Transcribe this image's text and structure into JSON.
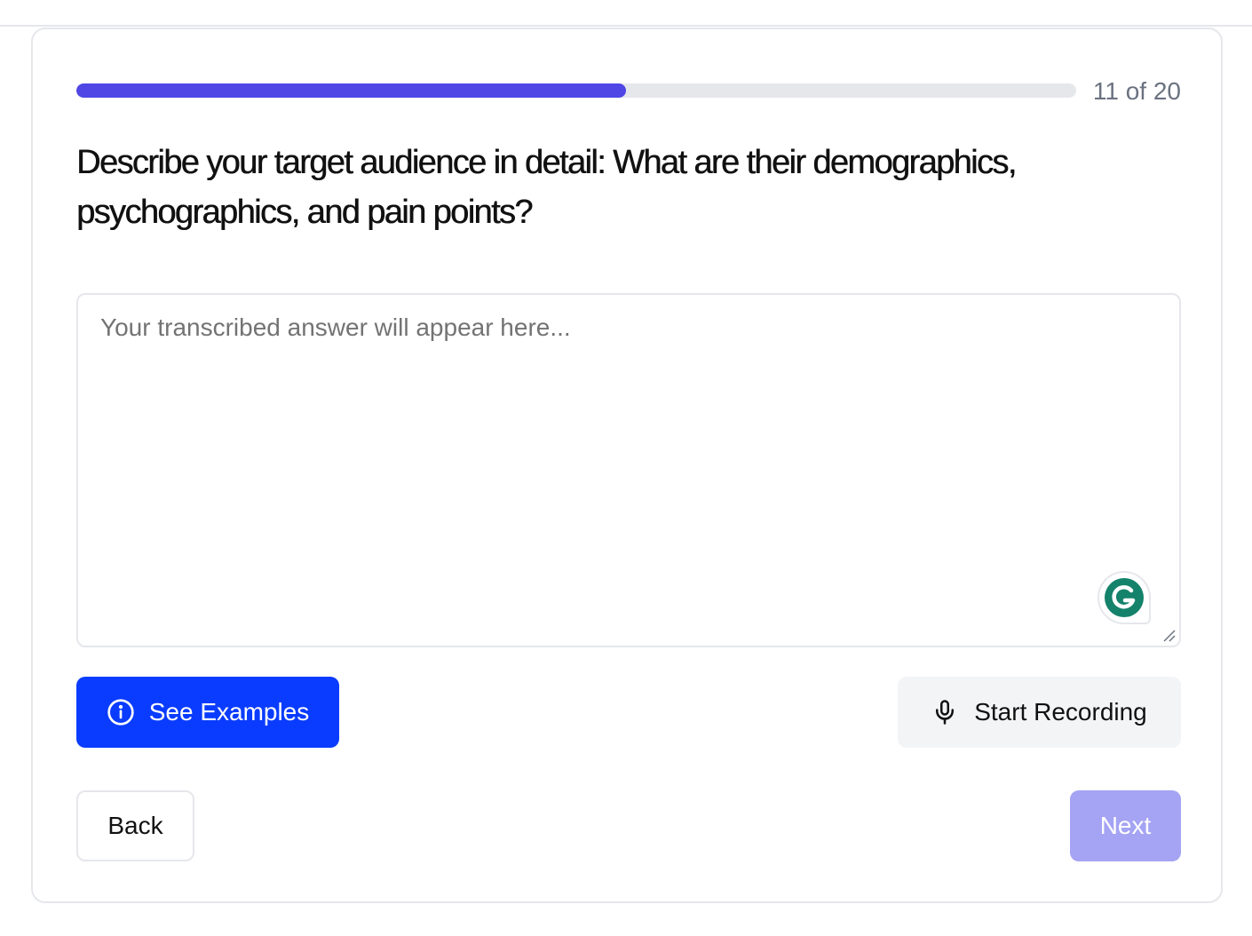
{
  "progress": {
    "current": 11,
    "total": 20,
    "fraction": 0.55,
    "label": "11 of 20",
    "fill_color": "#4f46e5",
    "track_color": "#e5e7eb"
  },
  "question": {
    "text": "Describe your target audience in detail: What are their demographics, psychographics, and pain points?"
  },
  "answer": {
    "value": "",
    "placeholder": "Your transcribed answer will appear here..."
  },
  "actions": {
    "see_examples_label": "See Examples",
    "see_examples_icon": "info-icon",
    "see_examples_color": "#0a3cff",
    "start_recording_label": "Start Recording",
    "start_recording_icon": "microphone-icon"
  },
  "navigation": {
    "back_label": "Back",
    "next_label": "Next",
    "next_color": "#a5a3f3"
  },
  "extensions": {
    "grammarly_icon": "grammarly-icon",
    "grammarly_color": "#15826b"
  }
}
